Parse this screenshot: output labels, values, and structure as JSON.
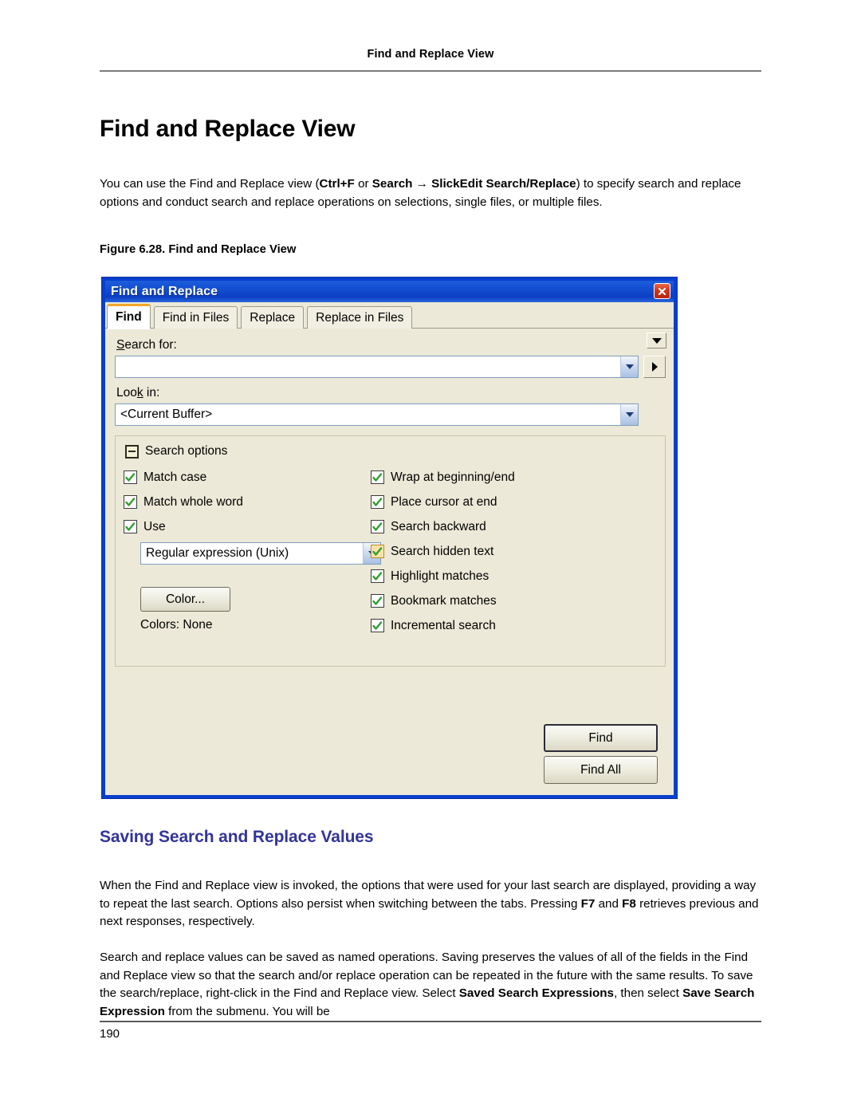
{
  "page": {
    "running_head": "Find and Replace View",
    "title": "Find and Replace View",
    "folio": "190",
    "figure_caption": "Figure 6.28.  Find and Replace View",
    "section_title": "Saving Search and Replace Values",
    "intro_paragraph": {
      "part1": "You can use the Find and Replace view (",
      "bold1": "Ctrl+F",
      "part2": " or ",
      "bold2": "Search",
      "arrow": " → ",
      "bold3": "SlickEdit Search/Replace",
      "part3": ") to specify search and replace options and conduct search and replace operations on selections, single files, or multiple files."
    },
    "paragraph2": {
      "part1": "When the Find and Replace view is invoked, the options that were used for your last search are displayed, providing a way to repeat the last search. Options also persist when switching between the tabs. Pressing ",
      "bold1": "F7",
      "part2": " and ",
      "bold2": "F8",
      "part3": " retrieves previous and next responses, respectively."
    },
    "paragraph3": {
      "part1": "Search and replace values can be saved as named operations. Saving preserves the values of all of the fields in the Find and Replace view so that the search and/or replace operation can be repeated in the future with the same results. To save the search/replace, right-click in the Find and Replace view. Select ",
      "bold1": "Saved Search Expressions",
      "part2": ", then select ",
      "bold2": "Save Search Expression",
      "part3": " from the submenu. You will be"
    }
  },
  "dialog": {
    "title": "Find and Replace",
    "close_icon": "close-icon",
    "collapse_arrow_icon": "chevron-down-icon",
    "tabs": [
      {
        "label": "Find",
        "active": true
      },
      {
        "label": "Find in Files",
        "active": false
      },
      {
        "label": "Replace",
        "active": false
      },
      {
        "label": "Replace in Files",
        "active": false
      }
    ],
    "search_for": {
      "label_pre": "S",
      "label_post": "earch for:",
      "value": "",
      "dropdown_icon": "chevron-down-icon",
      "more_button_icon": "play-right-icon"
    },
    "look_in": {
      "label_pre": "Loo",
      "label_mid": "k",
      "label_post": " in:",
      "value": "<Current Buffer>",
      "dropdown_icon": "chevron-down-icon"
    },
    "search_options": {
      "group_title": "Search options",
      "collapse_icon": "minus-box-icon",
      "left_checkboxes": [
        {
          "label": "Match case",
          "checked": true,
          "hot": false
        },
        {
          "label": "Match whole word",
          "checked": true,
          "hot": false
        },
        {
          "label": "Use",
          "checked": true,
          "hot": false
        }
      ],
      "regex_combo": {
        "value": "Regular expression (Unix)",
        "dropdown_icon": "chevron-down-icon"
      },
      "color_button": "Color...",
      "colors_status": "Colors: None",
      "right_checkboxes": [
        {
          "label": "Wrap at beginning/end",
          "checked": true,
          "hot": false
        },
        {
          "label": "Place cursor at end",
          "checked": true,
          "hot": false
        },
        {
          "label": "Search backward",
          "checked": true,
          "hot": false
        },
        {
          "label": "Search hidden text",
          "checked": true,
          "hot": true
        },
        {
          "label": "Highlight matches",
          "checked": true,
          "hot": false
        },
        {
          "label": "Bookmark matches",
          "checked": true,
          "hot": false
        },
        {
          "label": "Incremental search",
          "checked": true,
          "hot": false
        }
      ]
    },
    "buttons": {
      "find": "Find",
      "find_all": "Find All"
    },
    "colors": {
      "titlebar_blue": "#0c3fc4",
      "frame_blue": "#0a3fce",
      "client_face": "#ece9d8",
      "active_tab_accent": "#f0a82a",
      "close_red": "#d2351c",
      "check_green": "#2f9e2f"
    }
  },
  "theme": {
    "section_heading_color": "#33339c",
    "rule_color": "#7a7a7a"
  }
}
